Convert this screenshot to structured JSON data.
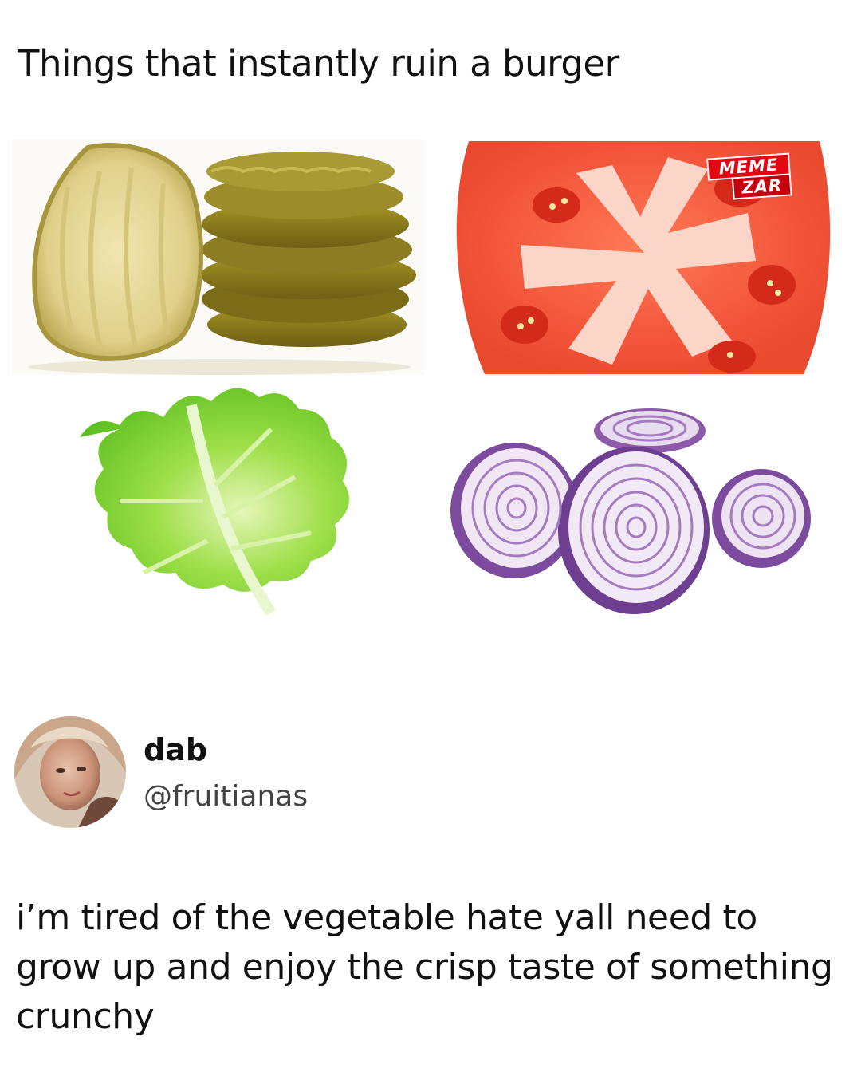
{
  "meme": {
    "title": "Things that instantly ruin a burger",
    "images": [
      {
        "name": "pickles",
        "icon": "pickle-slices-image"
      },
      {
        "name": "tomato",
        "icon": "tomato-slice-image"
      },
      {
        "name": "lettuce",
        "icon": "lettuce-leaf-image"
      },
      {
        "name": "onion",
        "icon": "red-onion-slices-image"
      }
    ],
    "watermark": {
      "line1": "MEME",
      "line2": "ZAR",
      "color": "#e30613"
    }
  },
  "tweet": {
    "display_name": "dab",
    "handle": "@fruitianas",
    "text": "i’m tired of the vegetable hate yall need to grow up and enjoy the crisp taste of something crunchy"
  }
}
